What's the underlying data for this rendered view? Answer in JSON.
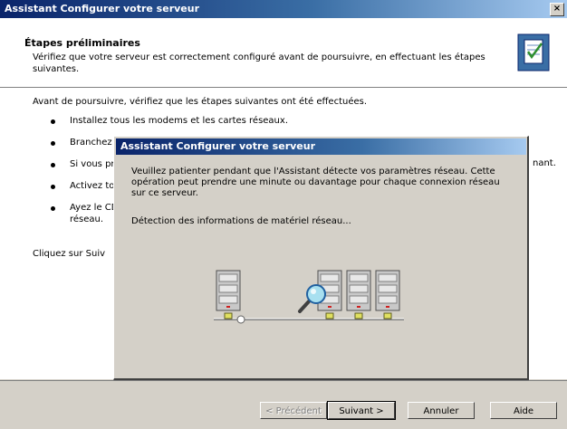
{
  "window": {
    "title": "Assistant Configurer votre serveur",
    "close_label": "×"
  },
  "header": {
    "title": "Étapes préliminaires",
    "subtitle": "Vérifiez que votre serveur est correctement configuré avant de poursuivre, en effectuant les étapes suivantes."
  },
  "content": {
    "intro": "Avant de poursuivre, vérifiez que les étapes suivantes ont été effectuées.",
    "bullets": [
      "Installez tous les modems et les cartes réseaux.",
      "Branchez t",
      "Si vous pro",
      "Activez tou",
      "Ayez le CD",
      "réseau."
    ],
    "bullet3_tail": "nant.",
    "footer": "Cliquez sur Suiv"
  },
  "buttons": {
    "back": "< Précédent",
    "next": "Suivant >",
    "cancel": "Annuler",
    "help": "Aide"
  },
  "dialog": {
    "title": "Assistant Configurer votre serveur",
    "message": "Veuillez patienter pendant que l'Assistant détecte vos paramètres réseau. Cette opération peut prendre une minute ou davantage pour chaque connexion réseau sur ce serveur.",
    "status": "Détection des informations de matériel réseau..."
  },
  "colors": {
    "titlebar_start": "#0a246a",
    "titlebar_end": "#a6caf0",
    "face": "#d4d0c8"
  }
}
